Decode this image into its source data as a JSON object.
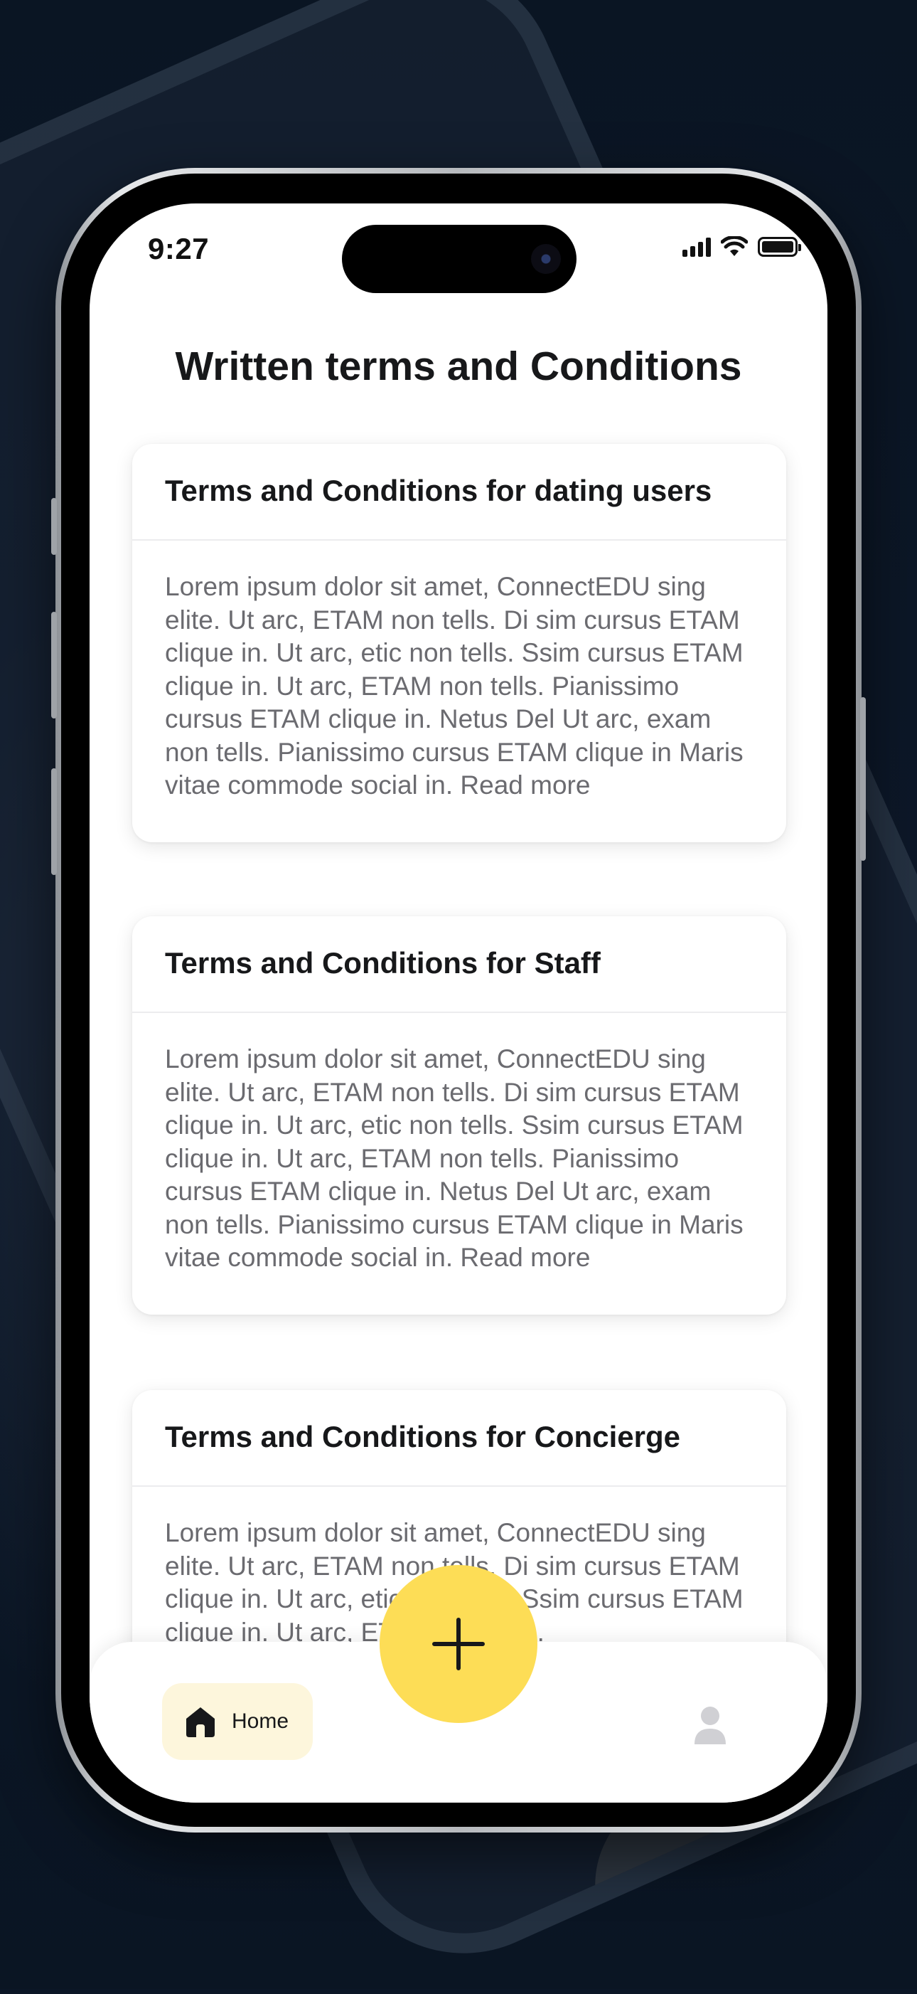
{
  "status_bar": {
    "time": "9:27"
  },
  "page": {
    "title": "Written terms and Conditions"
  },
  "cards": [
    {
      "title": "Terms and Conditions for dating users",
      "body": "Lorem ipsum dolor sit amet, ConnectEDU sing elite. Ut arc, ETAM non tells. Di sim cursus ETAM clique in. Ut arc, etic non tells. Ssim cursus ETAM clique in. Ut arc, ETAM non tells. Pianissimo cursus ETAM clique in. Netus Del Ut arc, exam non tells. Pianissimo cursus ETAM clique in Maris vitae commode social in. Read more"
    },
    {
      "title": "Terms and Conditions for Staff",
      "body": "Lorem ipsum dolor sit amet, ConnectEDU sing elite. Ut arc, ETAM non tells. Di sim cursus ETAM clique in. Ut arc, etic non tells. Ssim cursus ETAM clique in. Ut arc, ETAM non tells. Pianissimo cursus ETAM clique in. Netus Del Ut arc, exam non tells. Pianissimo cursus ETAM clique in Maris vitae commode social in. Read more"
    },
    {
      "title": "Terms and Conditions for Concierge",
      "body": "Lorem ipsum dolor sit amet, ConnectEDU sing elite. Ut arc, ETAM non tells. Di sim cursus ETAM clique in. Ut arc, etic non tells. Ssim cursus ETAM clique in. Ut arc, ETAM non tells."
    }
  ],
  "bottom_nav": {
    "home_label": "Home",
    "home_icon": "home-icon",
    "profile_icon": "user-icon",
    "fab_icon": "plus-icon"
  },
  "colors": {
    "accent": "#fddd56",
    "home_pill_bg": "#fdf6dc",
    "background": "#0b1626"
  }
}
